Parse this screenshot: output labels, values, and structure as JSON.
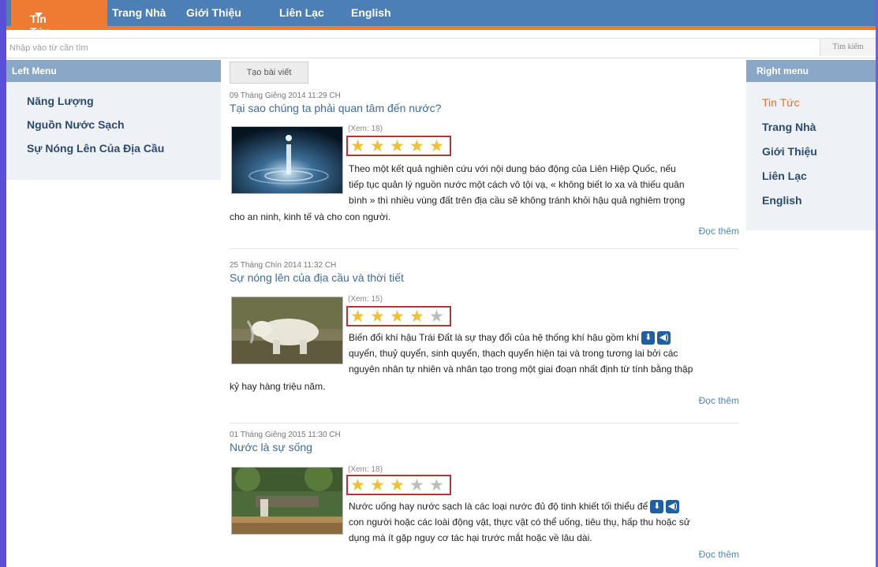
{
  "nav": {
    "items": [
      "Tin Tức",
      "Trang Nhà",
      "Giới Thiệu",
      "Liên Lạc",
      "English"
    ],
    "accent_color": "#ef7b32",
    "bar_color": "#4c7fb5"
  },
  "search": {
    "placeholder": "Nhập vào từ cần tìm",
    "button_label": "Tìm kiếm"
  },
  "left_menu": {
    "title": "Left Menu",
    "items": [
      "Năng Lượng",
      "Nguồn Nước Sạch",
      "Sự Nóng Lên Của Địa Cầu"
    ]
  },
  "right_menu": {
    "title": "Right menu",
    "items": [
      "Tin Tức",
      "Trang Nhà",
      "Giới Thiệu",
      "Liên Lạc",
      "English"
    ],
    "active_item": "Tin Tức"
  },
  "create_button": "Tạo bài viết",
  "articles": [
    {
      "date": "09 Tháng Giêng 2014  11:29 CH",
      "title": "Tại sao chúng ta phải quan tâm đến nước?",
      "views": "(Xem: 18)",
      "rating": 5,
      "image": "water-drop",
      "excerpt_lines": [
        "Theo một kết quả nghiên cứu với nội dung báo động của Liên Hiệp Quốc, nếu",
        "tiếp tục quản lý nguồn nước một cách vô tội vạ, « không biết lo xa và thiếu quân",
        "bình » thì nhiều vùng đất trên địa cầu sẽ không tránh khỏi hậu quả nghiêm trọng"
      ],
      "excerpt_tail": "cho an ninh, kinh tế và cho con người.",
      "read_more": "Đọc thêm"
    },
    {
      "date": "25 Tháng Chín 2014  11:32 CH",
      "title": "Sự nóng lên của địa cầu và thời tiết",
      "views": "(Xem: 15)",
      "rating": 4,
      "image": "polar-bear",
      "excerpt_lines": [
        "Biến đổi khí hậu Trái Đất là sự thay đổi của hệ thống khí hậu gồm khí",
        "quyển, thuỷ quyển, sinh quyển, thạch quyển hiện tại và trong tương lai bởi các",
        "nguyên nhân tự nhiên và nhân tạo trong một giai đoạn nhất định từ tính bằng thập"
      ],
      "excerpt_tail": "kỷ hay hàng triệu năm.",
      "read_more": "Đọc thêm",
      "has_icons": true
    },
    {
      "date": "01 Tháng Giêng 2015  11:30 CH",
      "title": "Nước là sự sống",
      "views": "(Xem: 18)",
      "rating": 3,
      "image": "waterfall",
      "excerpt_lines": [
        "Nước uống hay nước sạch là các loại nước đủ độ tinh khiết tối thiểu để",
        "con người hoặc các loài động vật, thực vật có thể uống, tiêu thụ, hấp thu hoặc sử",
        "dụng mà ít gặp nguy cơ tác hại trước mắt hoặc về lâu dài."
      ],
      "excerpt_tail": "",
      "read_more": "Đọc thêm",
      "has_icons": true
    }
  ],
  "colors": {
    "star_on": "#f0c030",
    "star_off": "#bdbdbd",
    "rating_box": "#b33535",
    "link": "#3e6c9c"
  }
}
